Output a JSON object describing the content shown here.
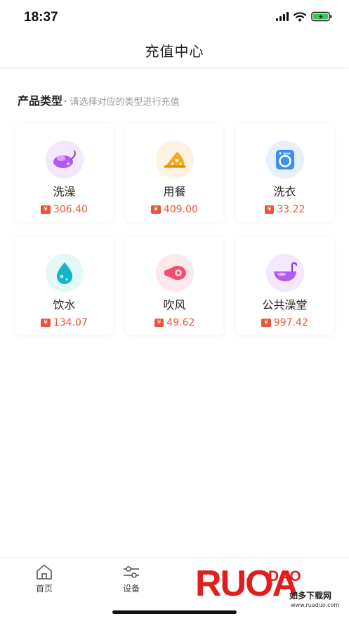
{
  "status_bar": {
    "time": "18:37"
  },
  "nav": {
    "title": "充值中心"
  },
  "section": {
    "title": "产品类型",
    "separator": "·",
    "hint": "请选择对应的类型进行充值"
  },
  "products": [
    {
      "label": "洗澡",
      "currency": "¥",
      "price": "306.40",
      "icon": "shower-icon",
      "color": "#a855f7"
    },
    {
      "label": "用餐",
      "currency": "¥",
      "price": "409.00",
      "icon": "pizza-icon",
      "color": "#f59e0b"
    },
    {
      "label": "洗衣",
      "currency": "¥",
      "price": "33.22",
      "icon": "washing-machine-icon",
      "color": "#3b82f6"
    },
    {
      "label": "饮水",
      "currency": "¥",
      "price": "134.07",
      "icon": "water-drop-icon",
      "color": "#14b8c8"
    },
    {
      "label": "吹风",
      "currency": "¥",
      "price": "49.62",
      "icon": "hair-dryer-icon",
      "color": "#f43f5e"
    },
    {
      "label": "公共澡堂",
      "currency": "¥",
      "price": "997.42",
      "icon": "bathtub-icon",
      "color": "#a855f7"
    }
  ],
  "tabbar": {
    "items": [
      {
        "label": "首页",
        "icon": "home-icon"
      },
      {
        "label": "设备",
        "icon": "sliders-icon"
      }
    ]
  },
  "watermark": {
    "letters": "RUOA",
    "brand": "DAO",
    "cn": "如多下载网",
    "url": "www.ruaduo.com"
  },
  "colors": {
    "price": "#e8563a",
    "brand_watermark": "#e21d1d"
  }
}
